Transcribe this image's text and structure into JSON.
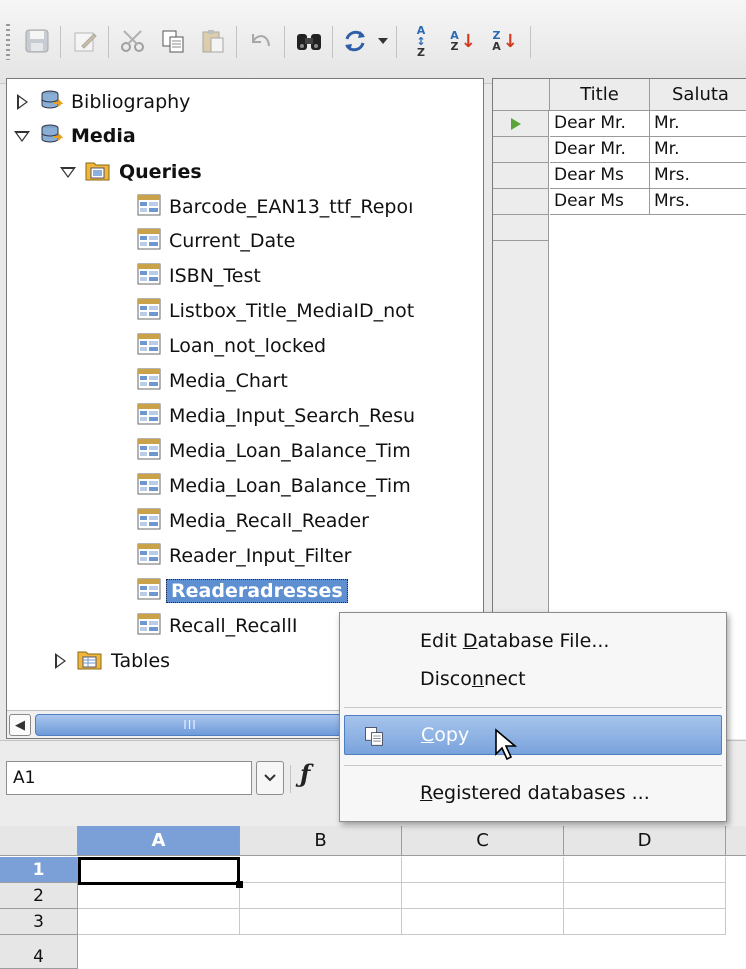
{
  "toolbar": {
    "buttons": [
      "save-icon",
      "edit-icon",
      "cut-icon",
      "copy-icon",
      "paste-icon",
      "undo-icon",
      "find-icon",
      "refresh-icon",
      "sort-ascending-icon",
      "sort-az-icon",
      "sort-za-icon"
    ]
  },
  "tree": {
    "items": [
      {
        "label": "Bibliography"
      },
      {
        "label": "Media"
      },
      {
        "label": "Queries"
      },
      {
        "label": "Barcode_EAN13_ttf_Repoı"
      },
      {
        "label": "Current_Date"
      },
      {
        "label": "ISBN_Test"
      },
      {
        "label": "Listbox_Title_MediaID_not"
      },
      {
        "label": "Loan_not_locked"
      },
      {
        "label": "Media_Chart"
      },
      {
        "label": "Media_Input_Search_Resu"
      },
      {
        "label": "Media_Loan_Balance_Tim"
      },
      {
        "label": "Media_Loan_Balance_Tim"
      },
      {
        "label": "Media_Recall_Reader"
      },
      {
        "label": "Reader_Input_Filter"
      },
      {
        "label": "Readeradresses"
      },
      {
        "label": "Recall_RecallI"
      },
      {
        "label": "Tables"
      }
    ],
    "scroll_thumb": "III"
  },
  "grid": {
    "headers": [
      "Title",
      "Saluta"
    ],
    "rows": [
      [
        "Dear Mr.",
        "Mr."
      ],
      [
        "Dear Mr.",
        "Mr."
      ],
      [
        "Dear Ms",
        "Mrs."
      ],
      [
        "Dear Ms",
        "Mrs."
      ]
    ]
  },
  "formula": {
    "name_box": "A1",
    "function_icon": "ƒ"
  },
  "sheet": {
    "columns": [
      "A",
      "B",
      "C",
      "D"
    ],
    "rows": [
      "1",
      "2",
      "3",
      "4"
    ]
  },
  "context_menu": {
    "items": [
      {
        "pre": "Edit ",
        "u": "D",
        "post": "atabase File..."
      },
      {
        "pre": "Disco",
        "u": "n",
        "post": "nect"
      },
      {
        "pre": "",
        "u": "C",
        "post": "opy"
      },
      {
        "pre": "",
        "u": "R",
        "post": "egistered databases ..."
      }
    ]
  },
  "colors": {
    "selection": "#5e8fd1",
    "highlight": "#7aa3dc",
    "row_marker": "#5aa53a"
  }
}
